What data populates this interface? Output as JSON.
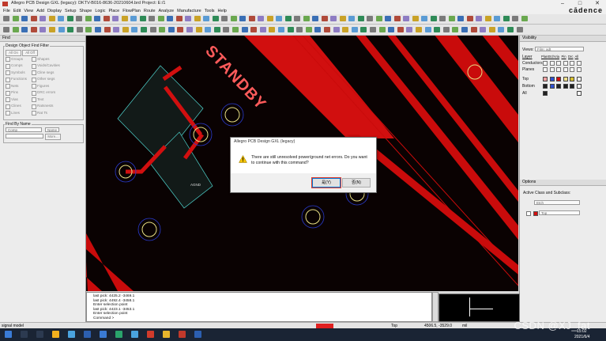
{
  "titlebar": {
    "title": "Allegro PCB Design GXL (legacy): DKTV-B016-8636-20210604.brd  Project: E:/1"
  },
  "brand": "cādence",
  "menu": [
    "File",
    "Edit",
    "View",
    "Add",
    "Display",
    "Setup",
    "Shape",
    "Logic",
    "Place",
    "FlowPlan",
    "Route",
    "Analyze",
    "Manufacture",
    "Tools",
    "Help"
  ],
  "find_panel": {
    "title": "Find",
    "group_title": "Design Object Find Filter",
    "all_on": "All On",
    "all_off": "All Off",
    "left_items": [
      "Groups",
      "Comps",
      "Symbols",
      "Functions",
      "Nets",
      "Pins",
      "Vias",
      "Clines",
      "Lines"
    ],
    "right_items": [
      "Shapes",
      "Voids/Cavities",
      "Cline segs",
      "Other segs",
      "Figures",
      "DRC errors",
      "Text",
      "Ratsnests",
      "Rat Ts"
    ],
    "find_by_name": "Find By Name",
    "name_type": "Comp",
    "name_mode": "Name",
    "more": "More..."
  },
  "canvas": {
    "text_standby": "STANDBY",
    "text_agnd": "AGND"
  },
  "visibility_panel": {
    "title": "Visibility",
    "views_label": "Views:",
    "views_value": "Film: adt",
    "col_header_layer": "Layer",
    "col_headers": [
      "Plan",
      "Etch",
      "Via",
      "Pin",
      "Drc",
      "All"
    ],
    "row_conductors": "Conductors",
    "row_planes": "Planes",
    "layers": [
      "Top",
      "Bottom",
      "All"
    ]
  },
  "options_panel": {
    "title": "Options",
    "subtitle": "Active Class and Subclass:",
    "class_value": "Etch",
    "subclass_value": "Top"
  },
  "command_area": {
    "lines": [
      "last pick:  4425.2 -3469.1",
      "last pick:  4492.4 -3458.1",
      "Enter selection point",
      "last pick:  4423.1 -3453.1",
      "Enter selection point",
      "Command >"
    ]
  },
  "statusbar": {
    "mode": "signal model",
    "layer": "Top",
    "coords": "4506.5, -3529.0",
    "unit": "mil",
    "status_color": "#e02020"
  },
  "dialog": {
    "title": "Allegro PCB Design GXL (legacy)",
    "message": "There are still unresolved power/ground net errors. Do you want to continue with this command?",
    "yes_label": "是(Y)",
    "no_label": "否(N)"
  },
  "taskbar": {
    "time": "15:02",
    "date": "2021/6/4"
  },
  "watermark": "CSDN @XJ_fat",
  "colors": {
    "etch": "#d10f0f",
    "canvas_bg": "#0a0202",
    "pad_outline": "#e8e085",
    "via_ring": "#2a3cd0",
    "shape_outline": "#4fd6d0"
  }
}
